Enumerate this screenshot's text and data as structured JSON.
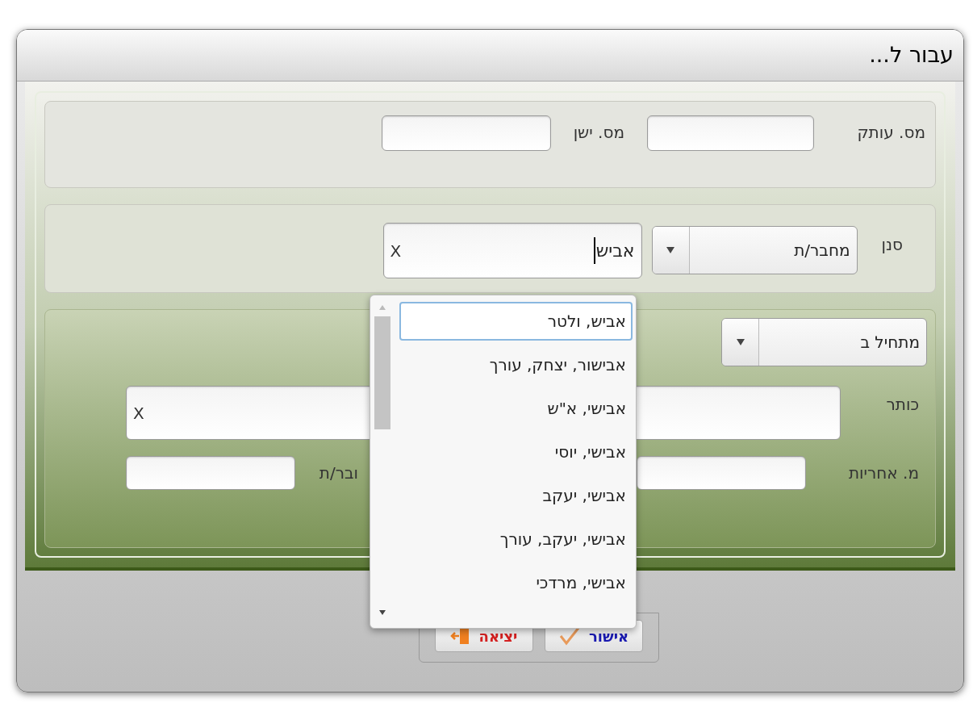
{
  "window": {
    "title": "עבור ל..."
  },
  "copy_field": {
    "label": "מס. עותק"
  },
  "old_field": {
    "label": "מס. ישן"
  },
  "filter": {
    "label": "סנן",
    "field_select": {
      "value": "מחבר/ת"
    },
    "search": {
      "value": "אביש",
      "clear": "X"
    }
  },
  "match_select": {
    "value": "מתחיל ב"
  },
  "title_field": {
    "label": "כותר",
    "clear": "X"
  },
  "responsibility_field": {
    "label": "מ. אחריות"
  },
  "author_field": {
    "label": "ובר/ת"
  },
  "suggestions": [
    {
      "label": "אביש, ולטר",
      "selected": true
    },
    {
      "label": "אבישור, יצחק, עורך",
      "selected": false
    },
    {
      "label": "אבישי, א\"ש",
      "selected": false
    },
    {
      "label": "אבישי, יוסי",
      "selected": false
    },
    {
      "label": "אבישי, יעקב",
      "selected": false
    },
    {
      "label": "אבישי, יעקב, עורך",
      "selected": false
    },
    {
      "label": "אבישי, מרדכי",
      "selected": false
    }
  ],
  "buttons": [
    {
      "label": "אישור",
      "kind": "ok"
    },
    {
      "label": "יציאה",
      "kind": "exit"
    }
  ]
}
